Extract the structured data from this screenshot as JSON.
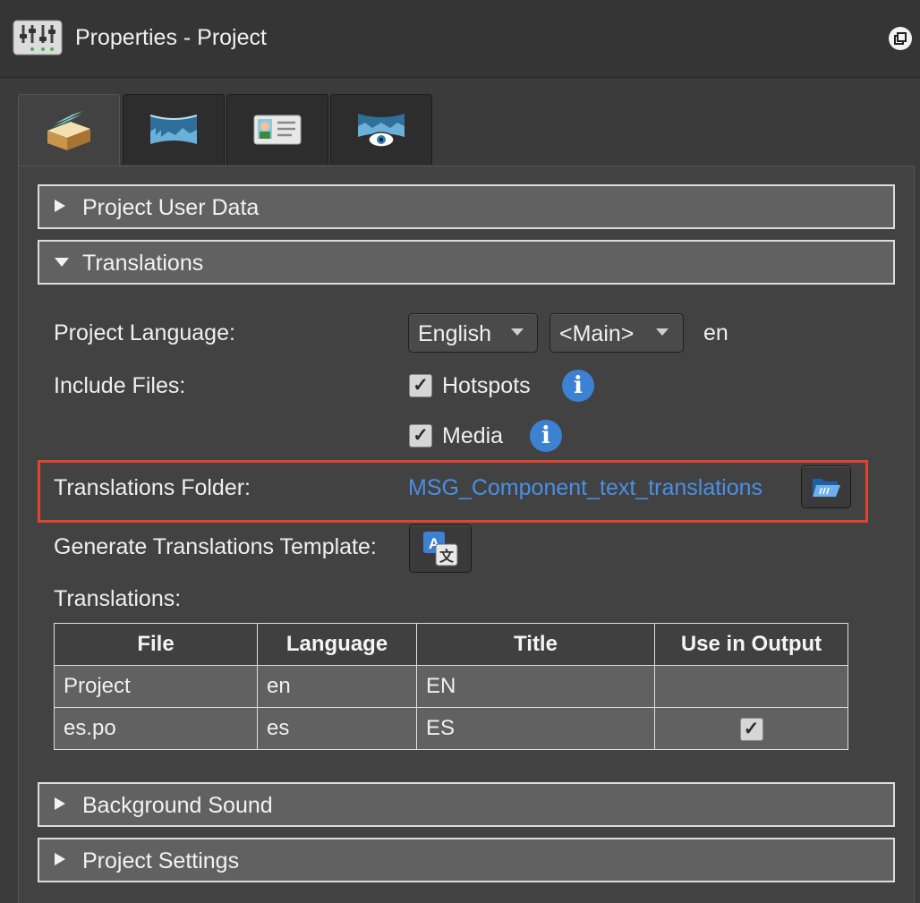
{
  "window": {
    "title": "Properties - Project"
  },
  "tabs": [
    {
      "icon": "project-box-icon"
    },
    {
      "icon": "panorama-icon"
    },
    {
      "icon": "id-card-icon"
    },
    {
      "icon": "panorama-viewer-icon"
    }
  ],
  "sections": {
    "user_data": "Project User Data",
    "translations": "Translations",
    "background_sound": "Background Sound",
    "project_settings": "Project Settings"
  },
  "form": {
    "project_language_label": "Project Language:",
    "language_value": "English",
    "variant_value": "<Main>",
    "language_code": "en",
    "include_files_label": "Include Files:",
    "hotspots_label": "Hotspots",
    "media_label": "Media",
    "checkmark": "✓",
    "info_glyph": "i",
    "translations_folder_label": "Translations Folder:",
    "translations_folder_value": "MSG_Component_text_translations",
    "generate_template_label": "Generate Translations Template:",
    "translations_label": "Translations:"
  },
  "table": {
    "headers": [
      "File",
      "Language",
      "Title",
      "Use in Output"
    ],
    "rows": [
      {
        "file": "Project",
        "language": "en",
        "title": "EN",
        "use_in_output": ""
      },
      {
        "file": "es.po",
        "language": "es",
        "title": "ES",
        "use_in_output": "✓"
      }
    ]
  },
  "colors": {
    "accent_link": "#4a8fe6",
    "highlight_border": "#e0442c",
    "info_blue": "#3d82d2"
  }
}
